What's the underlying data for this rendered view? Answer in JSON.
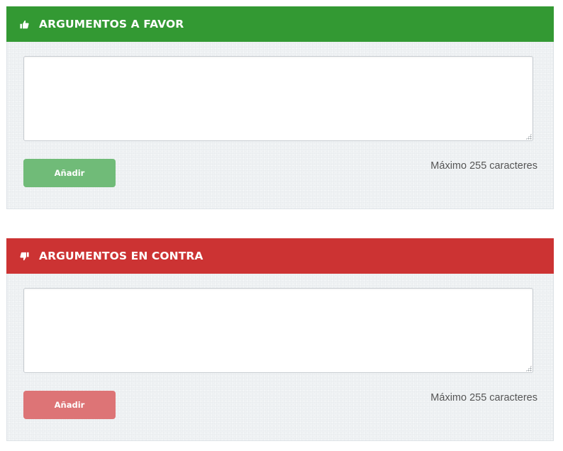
{
  "favor": {
    "icon": "thumbs-up-icon",
    "title": "ARGUMENTOS A FAVOR",
    "textarea_value": "",
    "button_label": "Añadir",
    "max_chars_note": "Máximo 255 caracteres",
    "header_color": "#339933",
    "button_color": "#70bb78"
  },
  "contra": {
    "icon": "thumbs-down-icon",
    "title": "ARGUMENTOS EN CONTRA",
    "textarea_value": "",
    "button_label": "Añadir",
    "max_chars_note": "Máximo 255 caracteres",
    "header_color": "#cc3333",
    "button_color": "#dd7476"
  }
}
